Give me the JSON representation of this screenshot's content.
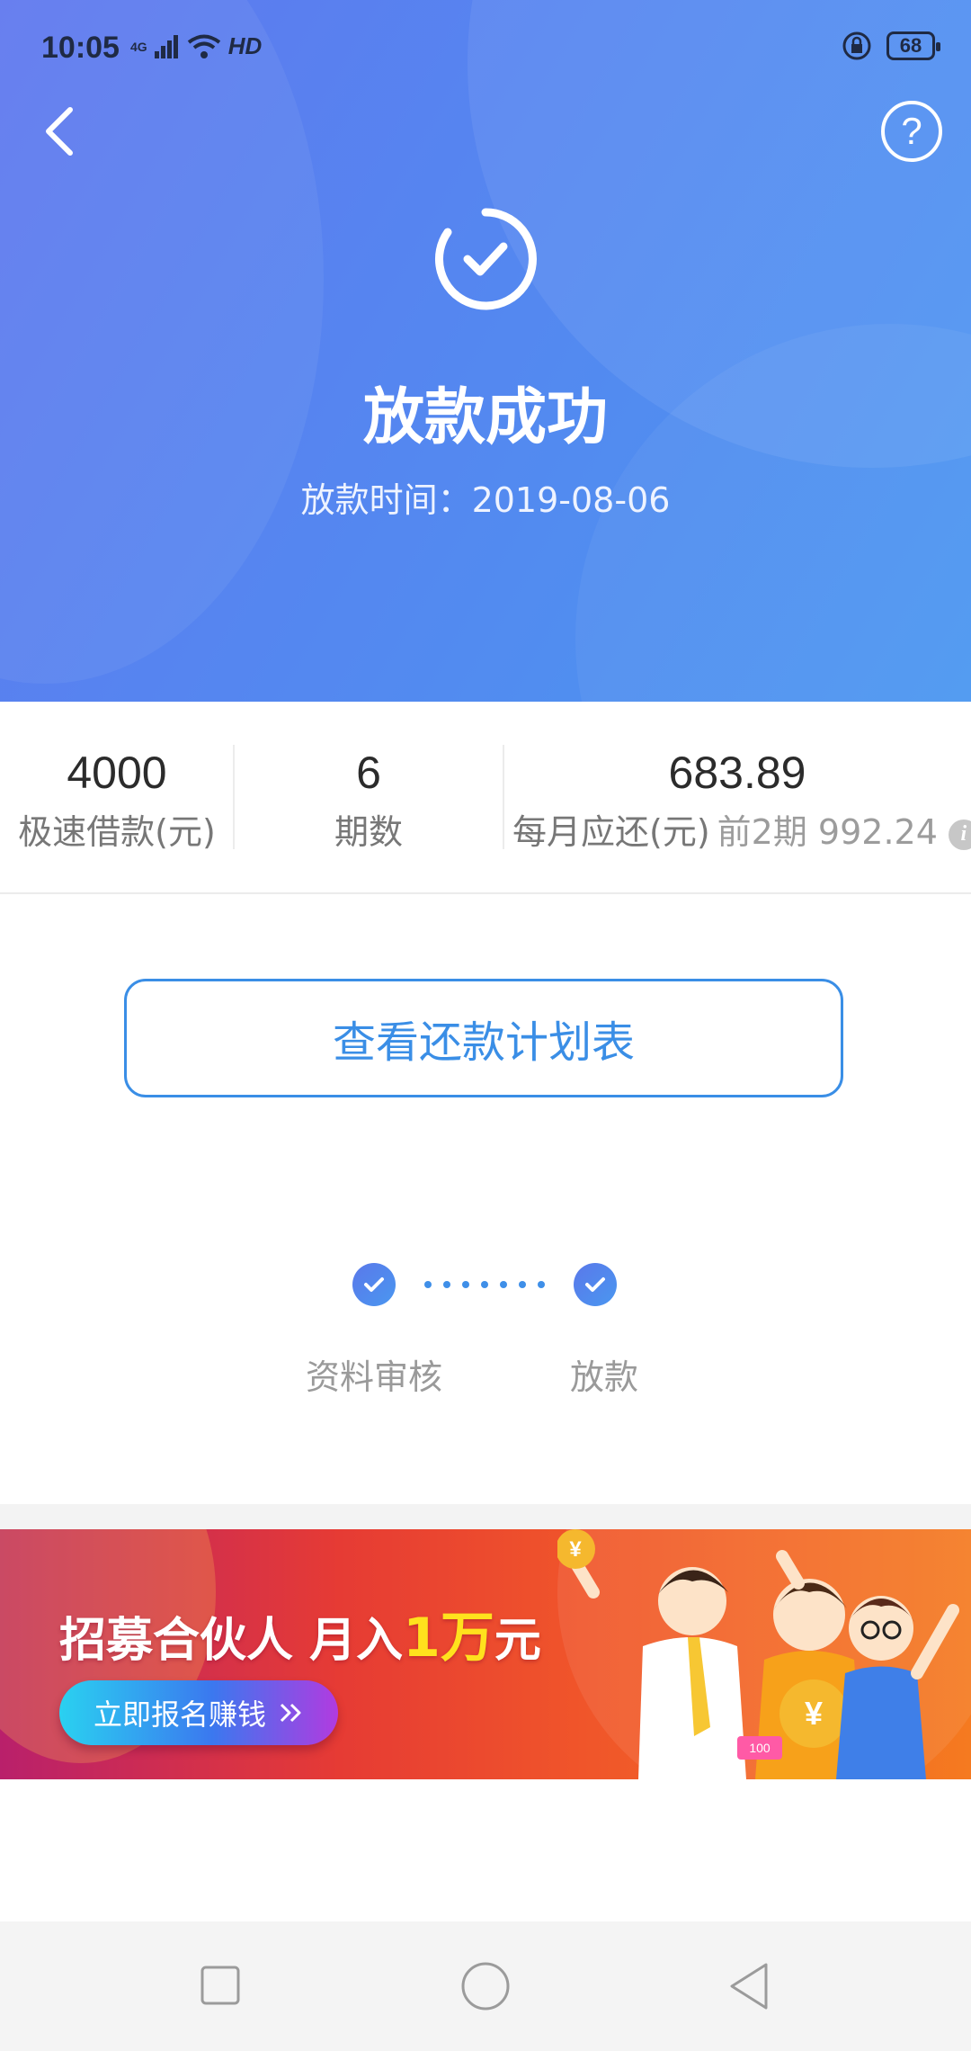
{
  "status_bar": {
    "time": "10:05",
    "network_label": "4G",
    "hd_label": "HD",
    "battery_level": "68"
  },
  "header": {
    "title": "放款成功",
    "time_text": "放款时间：2019-08-06"
  },
  "stats": {
    "amount_value": "4000",
    "amount_label": "极速借款(元)",
    "periods_value": "6",
    "periods_label": "期数",
    "monthly_value": "683.89",
    "monthly_label": "每月应还(元)",
    "monthly_sub": "前2期 992.24"
  },
  "buttons": {
    "plan_label": "查看还款计划表"
  },
  "steps": [
    {
      "label": "资料审核"
    },
    {
      "label": "放款"
    }
  ],
  "banner": {
    "title_part1": "招募合伙人 月入",
    "title_highlight": "1万",
    "title_part2": "元",
    "button_label": "立即报名赚钱",
    "coin_label": "¥",
    "ticket_label": "100"
  },
  "colors": {
    "header_start": "#5f78ee",
    "header_end": "#4b97f1",
    "accent": "#3a8ee6",
    "banner_highlight": "#ffe11d"
  }
}
